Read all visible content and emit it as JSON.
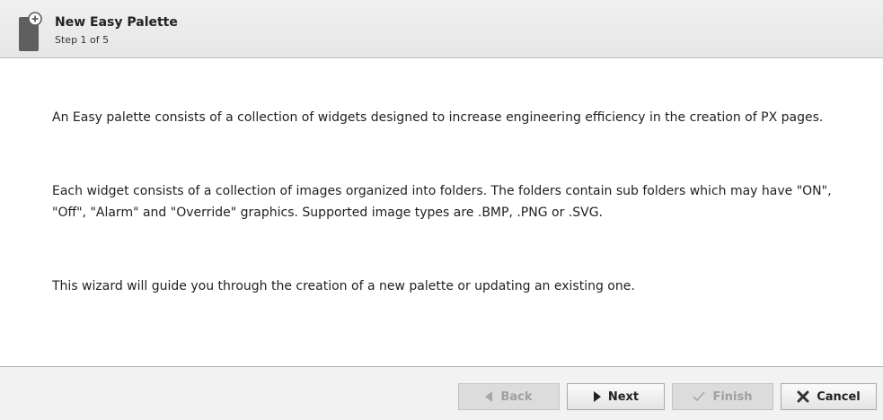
{
  "header": {
    "title": "New Easy Palette",
    "subtitle": "Step 1 of 5",
    "icon": "palette-add-icon"
  },
  "content": {
    "paragraphs": [
      "An Easy palette consists of a collection of widgets designed to increase engineering efficiency in the creation of PX pages.",
      "Each widget consists of a collection of images organized into folders. The folders contain sub folders which may have \"ON\", \"Off\", \"Alarm\" and \"Override\" graphics. Supported image types are .BMP, .PNG or .SVG.",
      "This wizard will guide you through the creation of a new palette or updating an existing one."
    ]
  },
  "buttons": {
    "back": {
      "label": "Back",
      "icon": "arrow-left-icon",
      "enabled": false
    },
    "next": {
      "label": "Next",
      "icon": "arrow-right-icon",
      "enabled": true
    },
    "finish": {
      "label": "Finish",
      "icon": "checkmark-icon",
      "enabled": false
    },
    "cancel": {
      "label": "Cancel",
      "icon": "x-icon",
      "enabled": true
    }
  }
}
